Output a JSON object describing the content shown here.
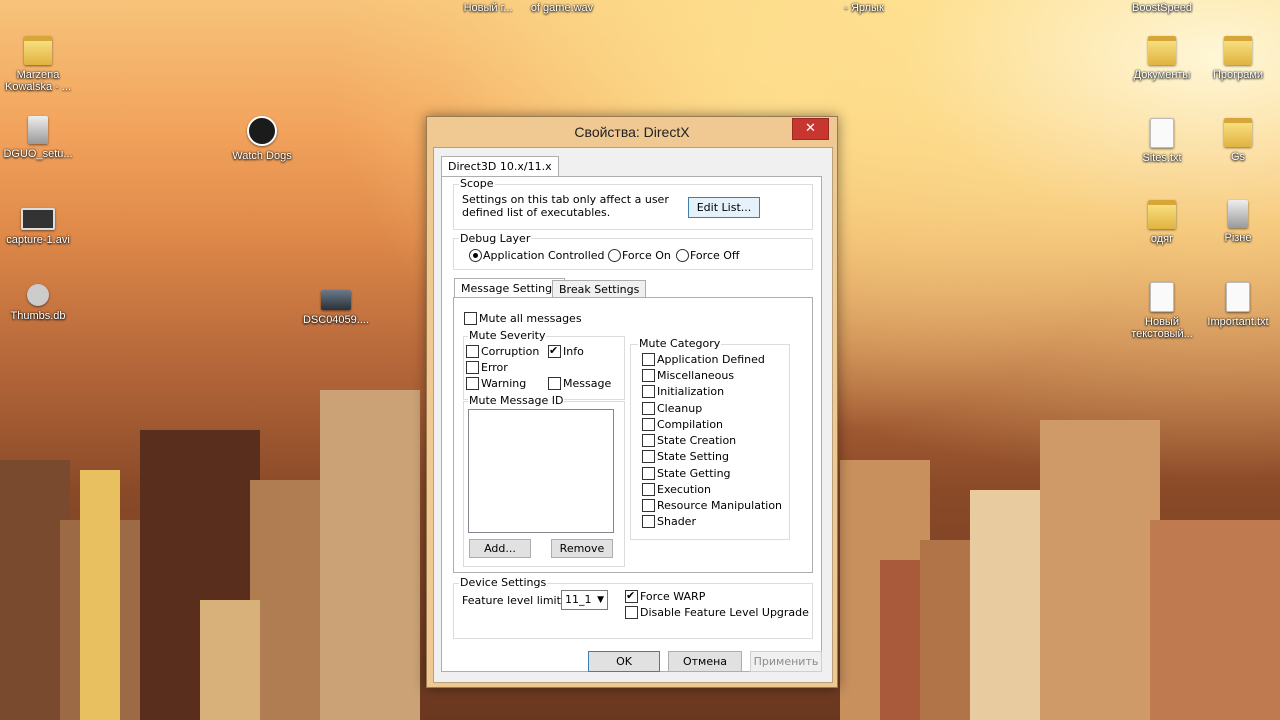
{
  "desktop": {
    "top_labels": [
      "Новый г...",
      "of game.wav",
      "- Ярлык",
      "BoostSpeed"
    ],
    "icons": [
      {
        "label": "Marzena Kowalska - ...",
        "kind": "folder"
      },
      {
        "label": "DGUO_setu...",
        "kind": "pic"
      },
      {
        "label": "Watch Dogs",
        "kind": "app"
      },
      {
        "label": "capture-1.avi",
        "kind": "video"
      },
      {
        "label": "Thumbs.db",
        "kind": "gear"
      },
      {
        "label": "DSC04059....",
        "kind": "photo"
      },
      {
        "label": "Документы",
        "kind": "folder"
      },
      {
        "label": "Програми",
        "kind": "folder"
      },
      {
        "label": "Sites.txt",
        "kind": "file"
      },
      {
        "label": "Gs",
        "kind": "folder"
      },
      {
        "label": "одяг",
        "kind": "folder"
      },
      {
        "label": "Різне",
        "kind": "pic"
      },
      {
        "label": "Новый текстовый...",
        "kind": "file"
      },
      {
        "label": "Important.txt",
        "kind": "file"
      }
    ]
  },
  "dialog": {
    "title": "Свойства: DirectX",
    "close": "✕",
    "outer_tab": "Direct3D 10.x/11.x",
    "scope": {
      "label": "Scope",
      "description_line1": "Settings on this tab only affect a user",
      "description_line2": "defined list of executables.",
      "edit_button": "Edit List..."
    },
    "debug_layer": {
      "label": "Debug Layer",
      "options": [
        "Application Controlled",
        "Force On",
        "Force Off"
      ],
      "selected": "Application Controlled"
    },
    "inner_tabs": [
      "Message Settings",
      "Break Settings"
    ],
    "message_settings": {
      "mute_all": "Mute all messages",
      "mute_severity": {
        "label": "Mute Severity",
        "items": [
          {
            "label": "Corruption",
            "checked": false
          },
          {
            "label": "Info",
            "checked": true
          },
          {
            "label": "Error",
            "checked": false
          },
          {
            "label": "Warning",
            "checked": false
          },
          {
            "label": "Message",
            "checked": false
          }
        ]
      },
      "mute_message_id": {
        "label": "Mute Message ID",
        "add_button": "Add...",
        "remove_button": "Remove"
      },
      "mute_category": {
        "label": "Mute Category",
        "items": [
          "Application Defined",
          "Miscellaneous",
          "Initialization",
          "Cleanup",
          "Compilation",
          "State Creation",
          "State Setting",
          "State Getting",
          "Execution",
          "Resource Manipulation",
          "Shader"
        ]
      }
    },
    "device_settings": {
      "label": "Device Settings",
      "feature_level_label": "Feature level limit:",
      "feature_level_value": "11_1",
      "force_warp": {
        "label": "Force WARP",
        "checked": true
      },
      "disable_upgrade": {
        "label": "Disable Feature Level Upgrade",
        "checked": false
      }
    },
    "buttons": {
      "ok": "OK",
      "cancel": "Отмена",
      "apply": "Применить"
    }
  },
  "colors": {
    "close_red": "#c7372f",
    "title_frame": "#f0c891"
  }
}
